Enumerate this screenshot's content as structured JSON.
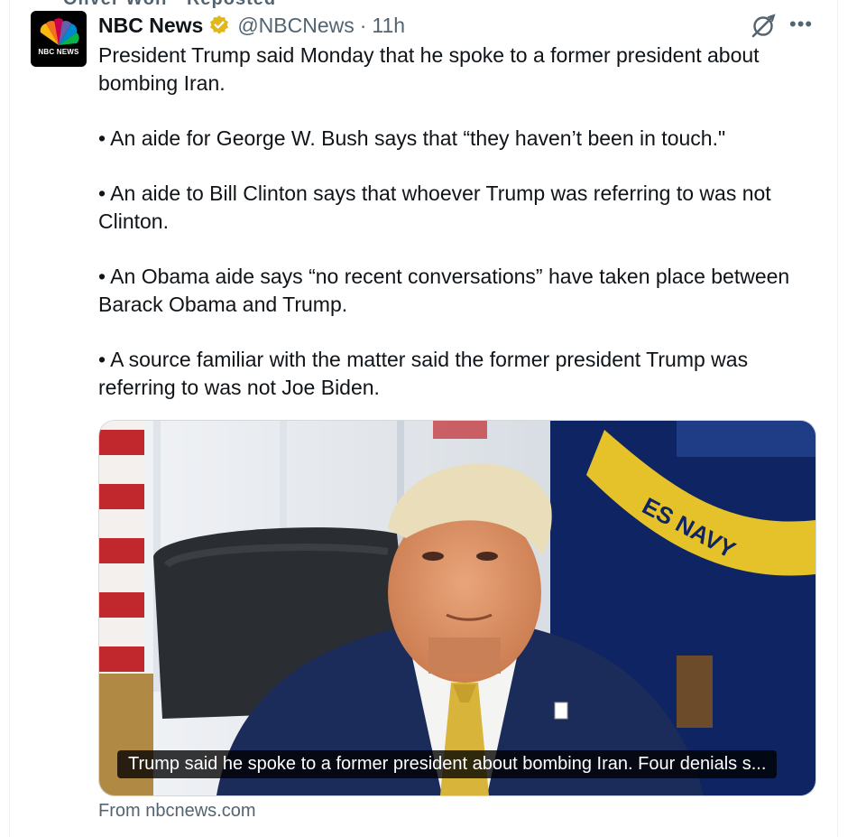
{
  "repost_strip": "Oliver Wolf · Reposted",
  "author": {
    "name": "NBC News",
    "handle": "@NBCNews",
    "separator": "·",
    "time": "11h",
    "avatar_text": "NBC NEWS",
    "verified": true,
    "badge_color": "#e2b719"
  },
  "tweet": {
    "paragraphs": [
      "President Trump said Monday that he spoke to a former president about bombing Iran.",
      "• An aide for George W. Bush says that “they haven’t been in touch.\"",
      "• An aide to Bill Clinton says that whoever Trump was referring to was not Clinton.",
      "• An Obama aide says “no recent conversations” have taken place between Barack Obama and Trump.",
      "• A source familiar with the matter said the former president Trump was referring to was not Joe Biden."
    ]
  },
  "card": {
    "caption": "Trump said he spoke to a former president about bombing Iran. Four denials s...",
    "flag_text": "ES NAVY",
    "source": "From nbcnews.com"
  },
  "icons": {
    "more": "more-options-icon",
    "grok": "grok-icon",
    "verified": "verified-badge-icon"
  },
  "colors": {
    "text": "#0f1419",
    "secondary": "#536471",
    "border": "#cfd9de"
  }
}
